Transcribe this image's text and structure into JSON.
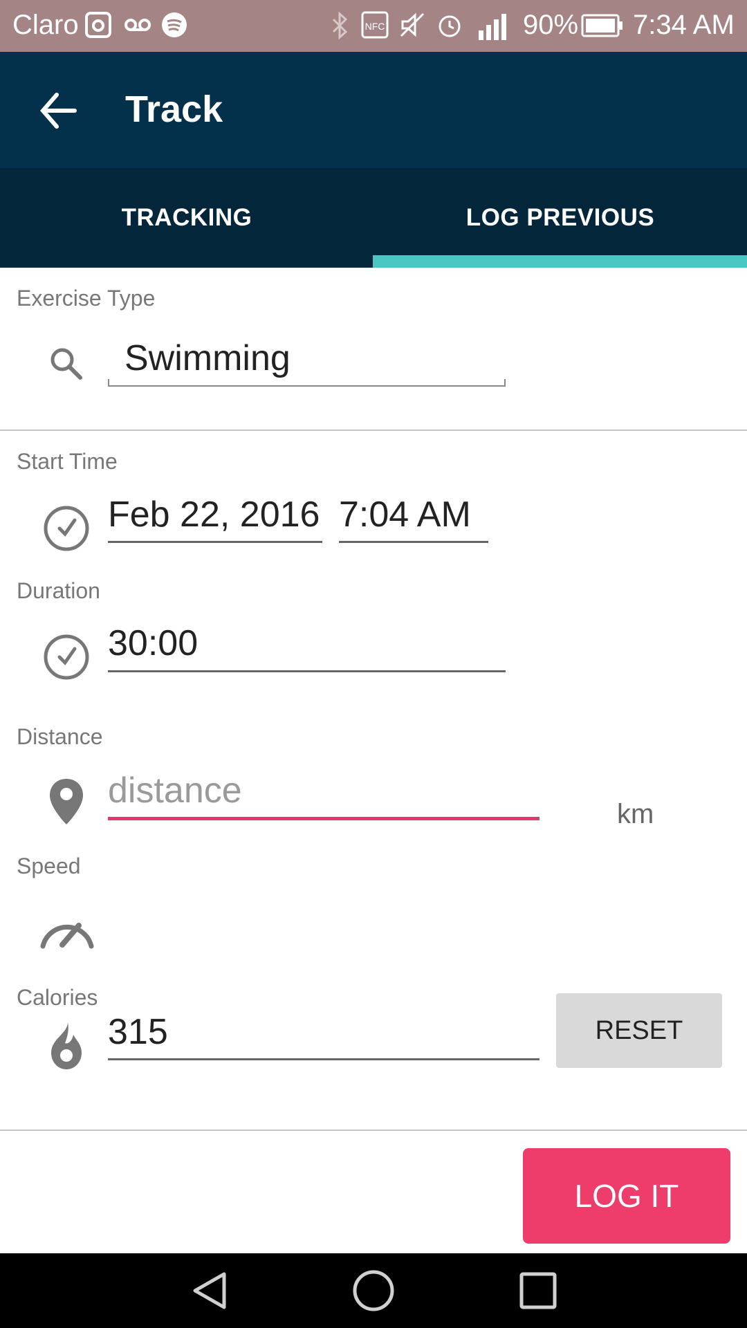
{
  "status_bar": {
    "carrier": "Claro",
    "battery_percent": "90%",
    "clock": "7:34 AM",
    "icons": [
      "instagram-icon",
      "voicemail-icon",
      "spotify-icon",
      "bluetooth-icon",
      "nfc-icon",
      "mute-icon",
      "alarm-icon",
      "signal-icon",
      "battery-icon"
    ]
  },
  "app_bar": {
    "title": "Track",
    "back_icon": "back-arrow-icon"
  },
  "tabs": [
    {
      "label": "TRACKING",
      "selected": false
    },
    {
      "label": "LOG PREVIOUS",
      "selected": true
    }
  ],
  "colors": {
    "app_bar": "#03304a",
    "tabs_bg": "#04263b",
    "tab_indicator": "#4ac6c2",
    "accent": "#ee3d6a",
    "status_bar": "#a58486"
  },
  "form": {
    "exercise_type": {
      "label": "Exercise Type",
      "value": "Swimming",
      "icon": "search-icon"
    },
    "start_time": {
      "label": "Start Time",
      "date": "Feb 22, 2016",
      "time": "7:04 AM",
      "icon": "clock-icon"
    },
    "duration": {
      "label": "Duration",
      "value": "30:00",
      "icon": "clock-icon"
    },
    "distance": {
      "label": "Distance",
      "placeholder": "distance",
      "unit": "km",
      "icon": "location-pin-icon"
    },
    "speed": {
      "label": "Speed",
      "icon": "speedometer-icon"
    },
    "calories": {
      "label": "Calories",
      "value": "315",
      "icon": "flame-icon",
      "reset_label": "RESET"
    }
  },
  "actions": {
    "log_it_label": "LOG IT"
  },
  "nav_bar": {
    "icons": [
      "back-triangle-icon",
      "home-circle-icon",
      "recents-square-icon"
    ]
  }
}
